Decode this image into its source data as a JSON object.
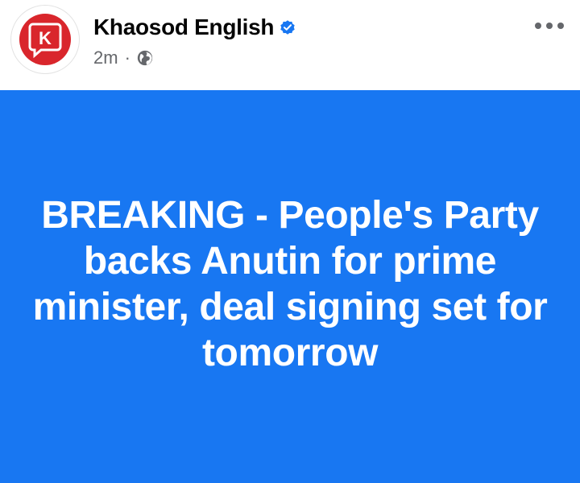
{
  "post": {
    "author": {
      "name": "Khaosod English",
      "verified": true,
      "avatar_letter": "K",
      "avatar_icon": "khaosod-logo-icon",
      "verified_icon": "verified-badge-icon"
    },
    "meta": {
      "time": "2m",
      "separator": "·",
      "audience_icon": "globe-icon"
    },
    "menu_icon": "more-options-icon",
    "headline": "BREAKING - People's Party backs Anutin for prime minister, deal signing set for tomorrow"
  },
  "colors": {
    "banner_background": "#1877f2",
    "headline_text": "#ffffff",
    "brand_red": "#d9262c",
    "verified_blue": "#1877f2",
    "meta_gray": "#65676b"
  }
}
